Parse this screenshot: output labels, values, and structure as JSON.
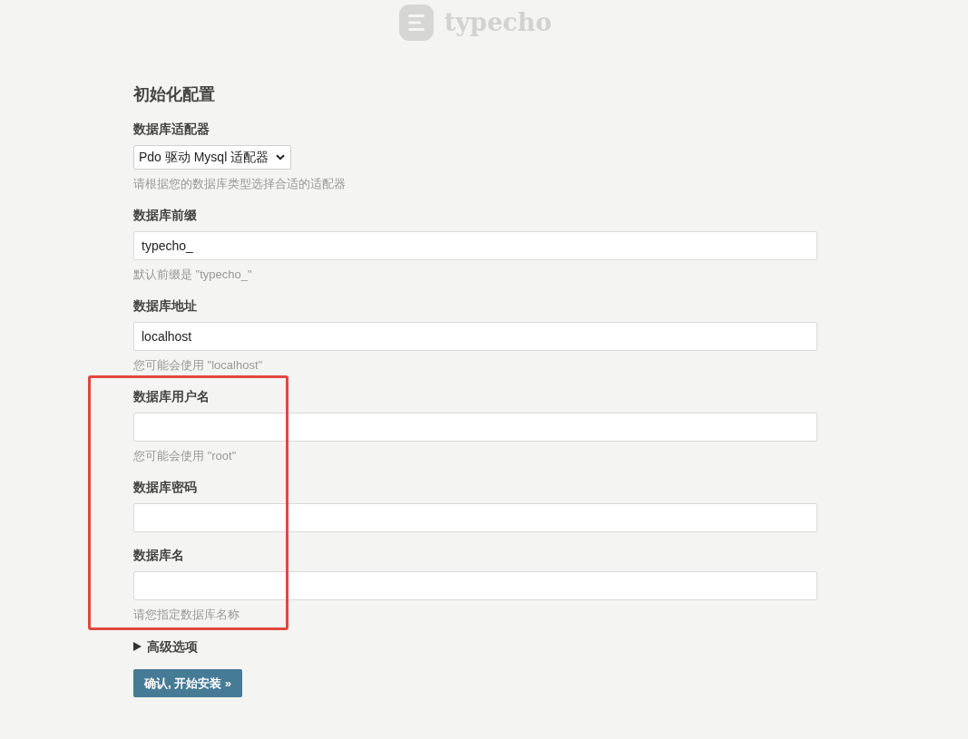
{
  "logo": {
    "text": "typecho"
  },
  "form": {
    "title": "初始化配置",
    "fields": [
      {
        "kind": "select",
        "label": "数据库适配器",
        "value": "Pdo 驱动 Mysql 适配器",
        "hint": "请根据您的数据库类型选择合适的适配器",
        "highlighted": false
      },
      {
        "kind": "input",
        "label": "数据库前缀",
        "value": "typecho_",
        "hint": "默认前缀是 \"typecho_\"",
        "highlighted": false
      },
      {
        "kind": "input",
        "label": "数据库地址",
        "value": "localhost",
        "hint": "您可能会使用 \"localhost\"",
        "highlighted": false
      },
      {
        "kind": "input",
        "label": "数据库用户名",
        "hint": "您可能会使用 \"root\"",
        "highlighted": true
      },
      {
        "kind": "input",
        "label": "数据库密码",
        "highlighted": true
      },
      {
        "kind": "input",
        "label": "数据库名",
        "hint": "请您指定数据库名称",
        "highlighted": true
      }
    ]
  },
  "advanced": {
    "label": "高级选项",
    "expanded": false
  },
  "submit": {
    "label": "确认, 开始安装 »"
  }
}
